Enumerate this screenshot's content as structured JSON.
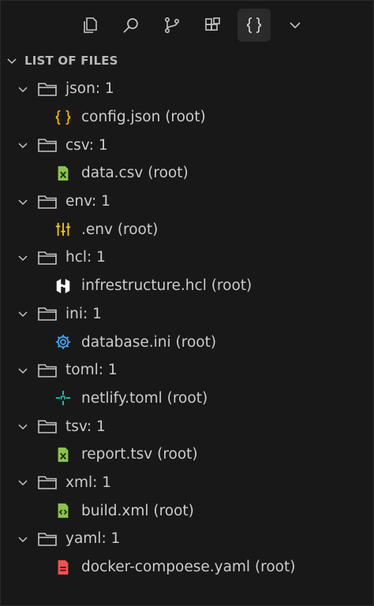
{
  "section": {
    "title": "LIST OF FILES"
  },
  "activity_bar": [
    {
      "name": "explorer-icon",
      "active": false
    },
    {
      "name": "search-icon",
      "active": false
    },
    {
      "name": "source-control-icon",
      "active": false
    },
    {
      "name": "extensions-icon",
      "active": false
    },
    {
      "name": "braces-icon",
      "active": true
    },
    {
      "name": "chevron-down-icon",
      "active": false
    }
  ],
  "groups": [
    {
      "label": "json: 1",
      "files": [
        {
          "label": "config.json (root)",
          "icon": "json-braces-icon",
          "color": "#f5b100"
        }
      ]
    },
    {
      "label": "csv: 1",
      "files": [
        {
          "label": "data.csv (root)",
          "icon": "csv-file-icon",
          "color": "#8bc34a"
        }
      ]
    },
    {
      "label": "env: 1",
      "files": [
        {
          "label": ".env (root)",
          "icon": "env-sliders-icon",
          "color": "#f5c518"
        }
      ]
    },
    {
      "label": "hcl: 1",
      "files": [
        {
          "label": "infrestructure.hcl (root)",
          "icon": "hashicorp-icon",
          "color": "#ffffff"
        }
      ]
    },
    {
      "label": "ini: 1",
      "files": [
        {
          "label": "database.ini (root)",
          "icon": "gear-icon",
          "color": "#42a5f5"
        }
      ]
    },
    {
      "label": "toml: 1",
      "files": [
        {
          "label": "netlify.toml (root)",
          "icon": "netlify-icon",
          "color": "#26c6b0"
        }
      ]
    },
    {
      "label": "tsv: 1",
      "files": [
        {
          "label": "report.tsv (root)",
          "icon": "tsv-file-icon",
          "color": "#8bc34a"
        }
      ]
    },
    {
      "label": "xml: 1",
      "files": [
        {
          "label": "build.xml (root)",
          "icon": "xml-file-icon",
          "color": "#8bc34a"
        }
      ]
    },
    {
      "label": "yaml: 1",
      "files": [
        {
          "label": "docker-compoese.yaml (root)",
          "icon": "yaml-file-icon",
          "color": "#ef5350"
        }
      ]
    }
  ]
}
